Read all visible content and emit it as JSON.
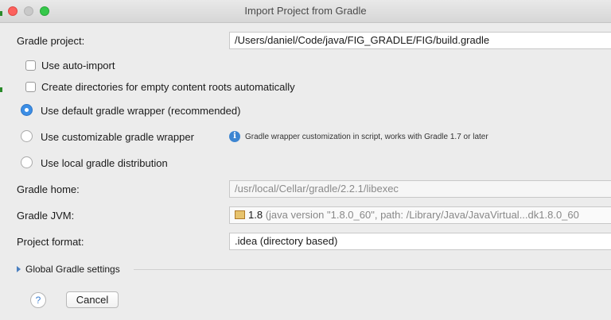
{
  "window": {
    "title": "Import Project from Gradle"
  },
  "gradle_project": {
    "label": "Gradle project:",
    "value": "/Users/daniel/Code/java/FIG_GRADLE/FIG/build.gradle"
  },
  "options": {
    "auto_import": {
      "label": "Use auto-import",
      "checked": false
    },
    "create_dirs": {
      "label": "Create directories for empty content roots automatically",
      "checked": false
    }
  },
  "wrapper": {
    "default": {
      "label": "Use default gradle wrapper (recommended)",
      "selected": true
    },
    "customizable": {
      "label": "Use customizable gradle wrapper",
      "selected": false,
      "hint": "Gradle wrapper customization in script, works with Gradle 1.7 or later"
    },
    "local": {
      "label": "Use local gradle distribution",
      "selected": false
    }
  },
  "gradle_home": {
    "label": "Gradle home:",
    "value": "/usr/local/Cellar/gradle/2.2.1/libexec"
  },
  "gradle_jvm": {
    "label": "Gradle JVM:",
    "version": "1.8",
    "detail": "(java version \"1.8.0_60\", path: /Library/Java/JavaVirtual...dk1.8.0_60"
  },
  "project_format": {
    "label": "Project format:",
    "value": ".idea (directory based)"
  },
  "global_settings": {
    "label": "Global Gradle settings",
    "expanded": false
  },
  "buttons": {
    "help": "?",
    "cancel": "Cancel"
  }
}
